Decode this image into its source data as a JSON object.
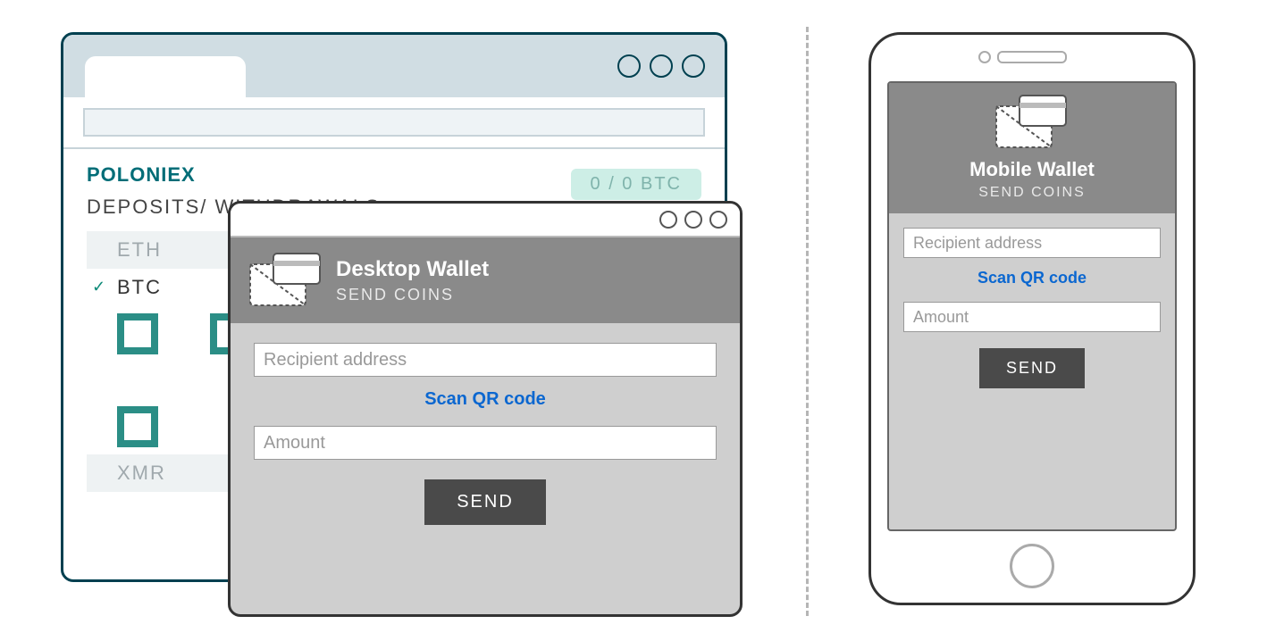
{
  "browser": {
    "brand": "POLONIEX",
    "balance": "0 / 0 BTC",
    "deposits_label": "DEPOSITS/ WITHDRAWALS",
    "coins": {
      "eth": "ETH",
      "btc": "BTC",
      "xmr": "XMR"
    }
  },
  "desktop_wallet": {
    "title": "Desktop Wallet",
    "subtitle": "SEND COINS",
    "recipient_placeholder": "Recipient address",
    "scan_qr": "Scan QR code",
    "amount_placeholder": "Amount",
    "send": "SEND"
  },
  "mobile_wallet": {
    "title": "Mobile Wallet",
    "subtitle": "SEND COINS",
    "recipient_placeholder": "Recipient address",
    "scan_qr": "Scan QR code",
    "amount_placeholder": "Amount",
    "send": "SEND"
  }
}
